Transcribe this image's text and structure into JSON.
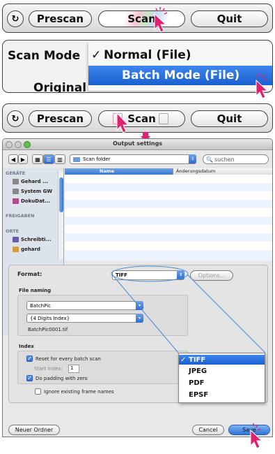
{
  "panel1": {
    "prescan_label": "Prescan",
    "scan_label": "Scan",
    "quit_label": "Quit"
  },
  "panel2": {
    "scan_mode_label": "Scan Mode",
    "partial_label": "Original",
    "menu_items": [
      {
        "check": "✓",
        "label": "Normal (File)"
      },
      {
        "check": "",
        "label": "Batch Mode (File)"
      }
    ]
  },
  "panel3": {
    "prescan_label": "Prescan",
    "scan_label": "Scan",
    "quit_label": "Quit"
  },
  "dialog": {
    "title": "Output settings",
    "location": "Scan folder",
    "search_placeholder": "suchen",
    "columns": [
      "Name",
      "Änderungsdatum"
    ],
    "sidebar": {
      "sections": [
        "GERÄTE",
        "FREIGABEN",
        "ORTE"
      ],
      "devices": [
        "Gehard ...",
        "System GW",
        "DokuDat..."
      ],
      "places": [
        "Schreibti...",
        "gehard"
      ]
    },
    "format_label": "Format:",
    "format_value": "TIFF",
    "options_label": "Options...",
    "file_naming": {
      "header": "File naming",
      "name_value": "BatchPic",
      "index_value": "{4 Digits Index}",
      "example": "BatchPic0001.tif"
    },
    "index": {
      "header": "Index",
      "reset_label": "Reset for every batch scan",
      "start_label": "Start index:",
      "start_value": "1",
      "padding_label": "Do padding with zero"
    },
    "ignore_label": "Ignore existing frame names",
    "new_folder_label": "Neuer Ordner",
    "cancel_label": "Cancel",
    "save_label": "Save"
  },
  "format_menu": [
    {
      "check": "✓",
      "label": "TIFF"
    },
    {
      "check": "",
      "label": "JPEG"
    },
    {
      "check": "",
      "label": "PDF"
    },
    {
      "check": "",
      "label": "EPSF"
    }
  ],
  "colors": {
    "accent_blue": "#1f6fe0",
    "cursor_pink": "#e0216f",
    "callout_line": "#4a8ad0"
  }
}
